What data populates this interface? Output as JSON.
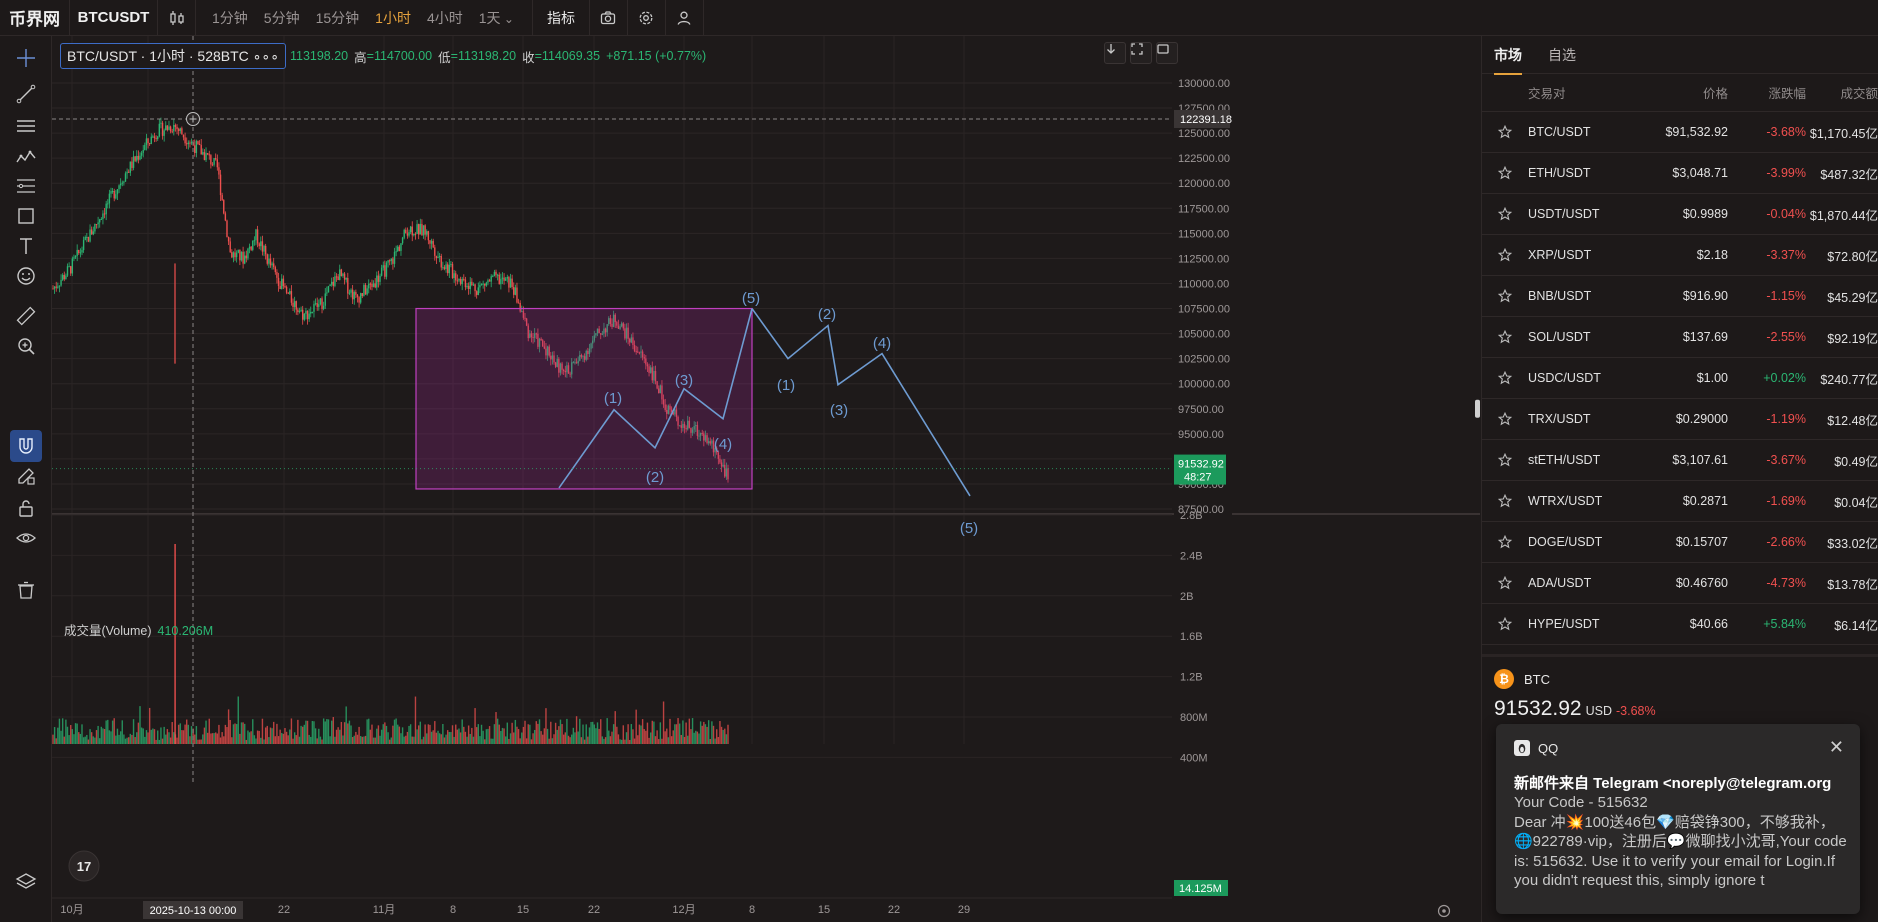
{
  "topbar": {
    "logo": "币界网",
    "symbol": "BTCUSDT",
    "intervals": [
      "1分钟",
      "5分钟",
      "15分钟",
      "1小时",
      "4小时",
      "1天"
    ],
    "active_interval": "1小时",
    "indicator_label": "指标"
  },
  "legend": {
    "symbol": "BTC/USDT · 1小时 · 528BTC",
    "dots": "∘∘∘",
    "open": "113198.20",
    "high_label": "高",
    "high": "=114700.00",
    "low_label": "低",
    "low": "=113198.20",
    "close_label": "收",
    "close": "=114069.35",
    "change": "+871.15 (+0.77%)"
  },
  "volume_legend": {
    "label": "成交量(Volume)",
    "value": "410.206M"
  },
  "price_axis": {
    "ticks": [
      "130000.00",
      "127500.00",
      "125000.00",
      "122500.00",
      "120000.00",
      "117500.00",
      "115000.00",
      "112500.00",
      "110000.00",
      "107500.00",
      "105000.00",
      "102500.00",
      "100000.00",
      "97500.00",
      "95000.00",
      "92500.00",
      "90000.00",
      "87500.00"
    ],
    "crosshair_label": "122391.18",
    "last_price": "91532.92",
    "countdown": "48:27"
  },
  "volume_axis": {
    "ticks": [
      "2.8B",
      "2.4B",
      "2B",
      "1.6B",
      "1.2B",
      "800M",
      "400M"
    ],
    "last_label": "14.125M"
  },
  "time_axis": {
    "ticks": [
      "10月",
      "8",
      "22",
      "11月",
      "8",
      "15",
      "22",
      "12月",
      "8",
      "15",
      "22",
      "29"
    ],
    "crosshair_label": "2025-10-13  00:00"
  },
  "wave_labels": {
    "first": [
      "(1)",
      "(2)",
      "(3)",
      "(4)",
      "(5)"
    ],
    "second": [
      "(1)",
      "(2)",
      "(3)",
      "(4)",
      "(5)"
    ]
  },
  "colors": {
    "up": "#2bb673",
    "down": "#f0504f",
    "box": "#c040c0",
    "wave": "#6e9bd1",
    "accent": "#e6a23c"
  },
  "market": {
    "tabs": [
      "市场",
      "自选"
    ],
    "headers": {
      "pair": "交易对",
      "price": "价格",
      "change": "涨跌幅",
      "volume": "成交额"
    },
    "rows": [
      {
        "pair": "BTC/USDT",
        "price": "$91,532.92",
        "change": "-3.68%",
        "volume": "$1,170.45亿"
      },
      {
        "pair": "ETH/USDT",
        "price": "$3,048.71",
        "change": "-3.99%",
        "volume": "$487.32亿"
      },
      {
        "pair": "USDT/USDT",
        "price": "$0.9989",
        "change": "-0.04%",
        "volume": "$1,870.44亿"
      },
      {
        "pair": "XRP/USDT",
        "price": "$2.18",
        "change": "-3.37%",
        "volume": "$72.80亿"
      },
      {
        "pair": "BNB/USDT",
        "price": "$916.90",
        "change": "-1.15%",
        "volume": "$45.29亿"
      },
      {
        "pair": "SOL/USDT",
        "price": "$137.69",
        "change": "-2.55%",
        "volume": "$92.19亿"
      },
      {
        "pair": "USDC/USDT",
        "price": "$1.00",
        "change": "+0.02%",
        "volume": "$240.77亿"
      },
      {
        "pair": "TRX/USDT",
        "price": "$0.29000",
        "change": "-1.19%",
        "volume": "$12.48亿"
      },
      {
        "pair": "stETH/USDT",
        "price": "$3,107.61",
        "change": "-3.67%",
        "volume": "$0.49亿"
      },
      {
        "pair": "WTRX/USDT",
        "price": "$0.2871",
        "change": "-1.69%",
        "volume": "$0.04亿"
      },
      {
        "pair": "DOGE/USDT",
        "price": "$0.15707",
        "change": "-2.66%",
        "volume": "$33.02亿"
      },
      {
        "pair": "ADA/USDT",
        "price": "$0.46760",
        "change": "-4.73%",
        "volume": "$13.78亿"
      },
      {
        "pair": "HYPE/USDT",
        "price": "$40.66",
        "change": "+5.84%",
        "volume": "$6.14亿"
      }
    ]
  },
  "detail": {
    "coin": "BTC",
    "coin_icon": "₿",
    "price": "91532.92",
    "unit": "USD",
    "change": "-3.68%"
  },
  "notification": {
    "app": "QQ",
    "subject": "新邮件来自 Telegram <noreply@telegram.org",
    "body": "Your Code - 515632\nDear 冲💥100送46包💎赔袋铮300，不够我补，🌐922789·vip，注册后💬微聊找小沈哥,Your code is: 515632. Use it to verify your email for Login.If you didn't request this, simply ignore t"
  },
  "chart_data": {
    "type": "candlestick",
    "ylim": [
      86000,
      131000
    ],
    "x": [
      "10月",
      "8",
      "22",
      "11月",
      "8",
      "15",
      "22",
      "12月",
      "8",
      "15",
      "22",
      "29"
    ],
    "price_path": [
      [
        0,
        109500
      ],
      [
        0.02,
        111500
      ],
      [
        0.05,
        116000
      ],
      [
        0.08,
        120500
      ],
      [
        0.1,
        123000
      ],
      [
        0.12,
        125200
      ],
      [
        0.14,
        125800
      ],
      [
        0.16,
        124000
      ],
      [
        0.18,
        122500
      ],
      [
        0.19,
        121500
      ],
      [
        0.205,
        113000
      ],
      [
        0.22,
        112500
      ],
      [
        0.235,
        114800
      ],
      [
        0.25,
        112000
      ],
      [
        0.27,
        109000
      ],
      [
        0.29,
        106800
      ],
      [
        0.31,
        108000
      ],
      [
        0.33,
        111000
      ],
      [
        0.35,
        108500
      ],
      [
        0.37,
        110000
      ],
      [
        0.39,
        112000
      ],
      [
        0.41,
        115500
      ],
      [
        0.43,
        115200
      ],
      [
        0.45,
        112000
      ],
      [
        0.47,
        110500
      ],
      [
        0.49,
        109500
      ],
      [
        0.51,
        110500
      ],
      [
        0.53,
        110000
      ],
      [
        0.55,
        105000
      ],
      [
        0.57,
        103500
      ],
      [
        0.59,
        101000
      ],
      [
        0.61,
        102500
      ],
      [
        0.63,
        105000
      ],
      [
        0.65,
        106500
      ],
      [
        0.67,
        104000
      ],
      [
        0.69,
        101500
      ],
      [
        0.71,
        97500
      ],
      [
        0.73,
        95800
      ],
      [
        0.75,
        95000
      ],
      [
        0.77,
        92800
      ],
      [
        0.78,
        90500
      ]
    ],
    "volume_peak": 2800000000,
    "box": {
      "x_range": [
        0.55,
        1.0
      ],
      "y_range": [
        89500,
        107500
      ]
    },
    "projected_waves": [
      {
        "labels": [
          "(1)",
          "(2)",
          "(3)",
          "(4)",
          "(5)"
        ],
        "points": [
          [
            0,
            89600
          ],
          [
            1,
            97400
          ],
          [
            2,
            93600
          ],
          [
            3,
            99500
          ],
          [
            4,
            96500
          ],
          [
            5,
            107500
          ]
        ]
      },
      {
        "labels": [
          "(1)",
          "(2)",
          "(3)",
          "(4)",
          "(5)"
        ],
        "points": [
          [
            0,
            107500
          ],
          [
            1,
            102500
          ],
          [
            2,
            105800
          ],
          [
            3,
            99900
          ],
          [
            4,
            103000
          ],
          [
            5,
            88800
          ]
        ]
      }
    ]
  }
}
